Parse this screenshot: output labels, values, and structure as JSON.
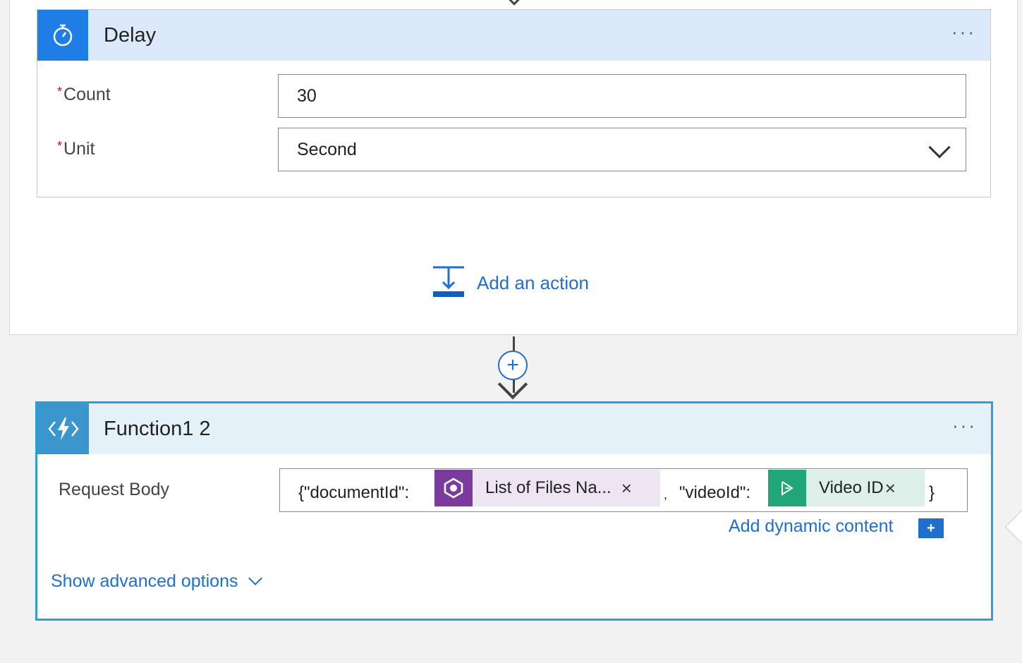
{
  "delay": {
    "title": "Delay",
    "more_label": "···",
    "count": {
      "required_mark": "*",
      "label": "Count",
      "value": "30"
    },
    "unit": {
      "required_mark": "*",
      "label": "Unit",
      "value": "Second"
    },
    "icon": "timer-icon",
    "header_color": "#dce9fb",
    "icon_color": "#1f7de6"
  },
  "add_action": {
    "label": "Add an action",
    "icon": "add-action-icon"
  },
  "connector": {
    "plus_label": "+"
  },
  "function": {
    "title": "Function1 2",
    "more_label": "···",
    "icon": "azure-function-icon",
    "request_body": {
      "label": "Request Body",
      "prefix": "{\"documentId\":",
      "token1": {
        "label": "List of Files Na...",
        "close": "×",
        "icon": "document-token-icon",
        "color": "#7a3b9c",
        "bg": "#eee5f2"
      },
      "separator": ",",
      "mid": "\"videoId\":",
      "token2": {
        "label": "Video ID",
        "close": "×",
        "icon": "video-indexer-token-icon",
        "color": "#21a67a",
        "bg": "#dcefe8"
      },
      "suffix": "}"
    },
    "dynamic_content": {
      "label": "Add dynamic content",
      "plus": "+"
    },
    "advanced": {
      "label": "Show advanced options"
    },
    "border_color": "#2d9fd3"
  }
}
